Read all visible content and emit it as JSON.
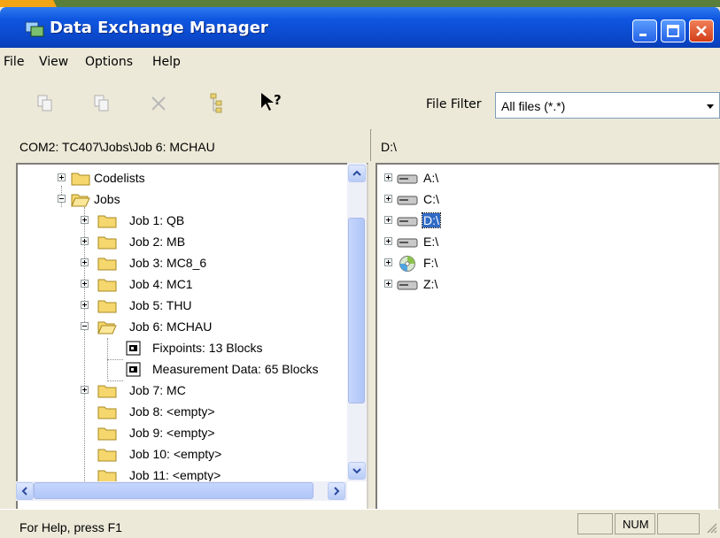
{
  "window": {
    "title": "Data Exchange Manager"
  },
  "menu": {
    "items": [
      "File",
      "View",
      "Options",
      "Help"
    ]
  },
  "toolbar": {
    "filter_label": "File Filter",
    "filter_value": "All files (*.*)"
  },
  "paths": {
    "left": "COM2: TC407\\Jobs\\Job 6: MCHAU",
    "right": "D:\\"
  },
  "left_tree": [
    {
      "label": "Codelists"
    },
    {
      "label": "Jobs"
    },
    {
      "label": "Job 1: QB"
    },
    {
      "label": "Job 2: MB"
    },
    {
      "label": "Job 3: MC8_6"
    },
    {
      "label": "Job 4: MC1"
    },
    {
      "label": "Job 5: THU"
    },
    {
      "label": "Job 6: MCHAU"
    },
    {
      "label": "Fixpoints: 13 Blocks"
    },
    {
      "label": "Measurement Data: 65 Blocks"
    },
    {
      "label": "Job 7: MC"
    },
    {
      "label": "Job 8: <empty>"
    },
    {
      "label": "Job 9: <empty>"
    },
    {
      "label": "Job 10: <empty>"
    },
    {
      "label": "Job 11: <empty>"
    }
  ],
  "right_tree": [
    {
      "label": "A:\\",
      "icon": "drive-icon"
    },
    {
      "label": "C:\\",
      "icon": "drive-icon"
    },
    {
      "label": "D:\\",
      "icon": "drive-icon",
      "selected": true
    },
    {
      "label": "E:\\",
      "icon": "drive-icon"
    },
    {
      "label": "F:\\",
      "icon": "cd-drive-icon"
    },
    {
      "label": "Z:\\",
      "icon": "drive-icon"
    }
  ],
  "status": {
    "help_text": "For Help, press F1",
    "num": "NUM"
  },
  "colors": {
    "title_blue": "#0a46c8",
    "selection": "#316ac5",
    "folder": "#f5d76e",
    "close_red": "#d23d18"
  }
}
